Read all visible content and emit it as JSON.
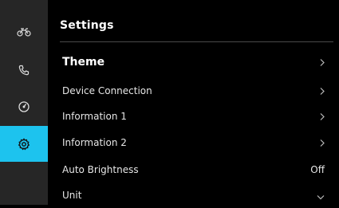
{
  "header": {
    "title": "Settings"
  },
  "sidebar": {
    "items": [
      {
        "icon": "motorcycle-icon",
        "active": false
      },
      {
        "icon": "phone-icon",
        "active": false
      },
      {
        "icon": "speedometer-icon",
        "active": false
      },
      {
        "icon": "gear-icon",
        "active": true
      }
    ],
    "active_color": "#1dc3ee"
  },
  "menu": {
    "items": [
      {
        "label": "Theme",
        "indicator": "chevron-right-icon"
      },
      {
        "label": "Device Connection",
        "indicator": "chevron-right-icon"
      },
      {
        "label": "Information 1",
        "indicator": "chevron-right-icon"
      },
      {
        "label": "Information 2",
        "indicator": "chevron-right-icon"
      },
      {
        "label": "Auto Brightness",
        "value": "Off"
      },
      {
        "label": "Unit",
        "indicator": "chevron-down-icon"
      }
    ]
  }
}
